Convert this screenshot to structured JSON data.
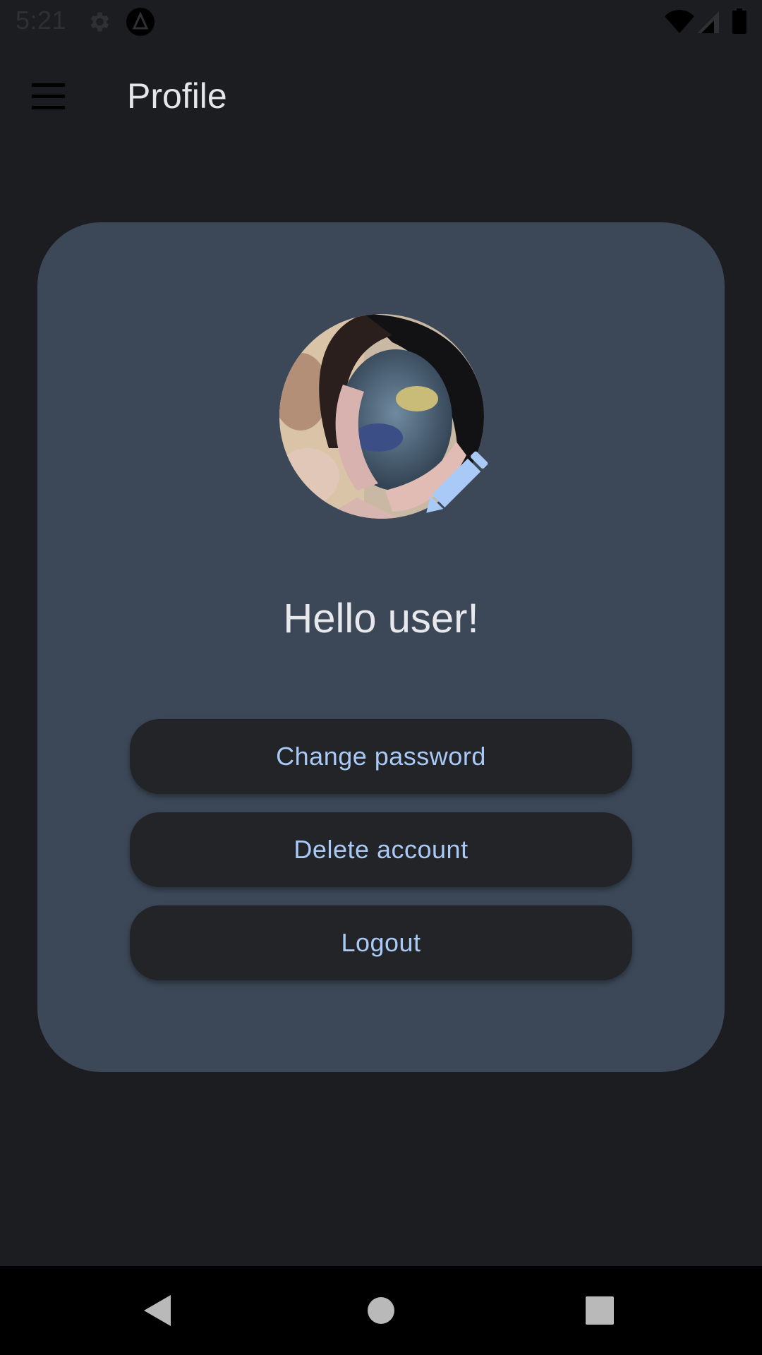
{
  "status_bar": {
    "time": "5:21",
    "icons": [
      "settings-icon",
      "app-notification-icon",
      "wifi-icon",
      "cellular-signal-icon",
      "battery-icon"
    ]
  },
  "app_bar": {
    "title": "Profile",
    "menu_icon": "hamburger-menu-icon"
  },
  "profile": {
    "greeting": "Hello user!",
    "edit_icon": "pencil-icon",
    "accent_color": "#a9c9f6",
    "card_color": "#3c4858"
  },
  "actions": {
    "change_password": "Change password",
    "delete_account": "Delete account",
    "logout": "Logout"
  },
  "nav_bar": {
    "icons": [
      "back-icon",
      "home-icon",
      "recents-icon"
    ]
  }
}
